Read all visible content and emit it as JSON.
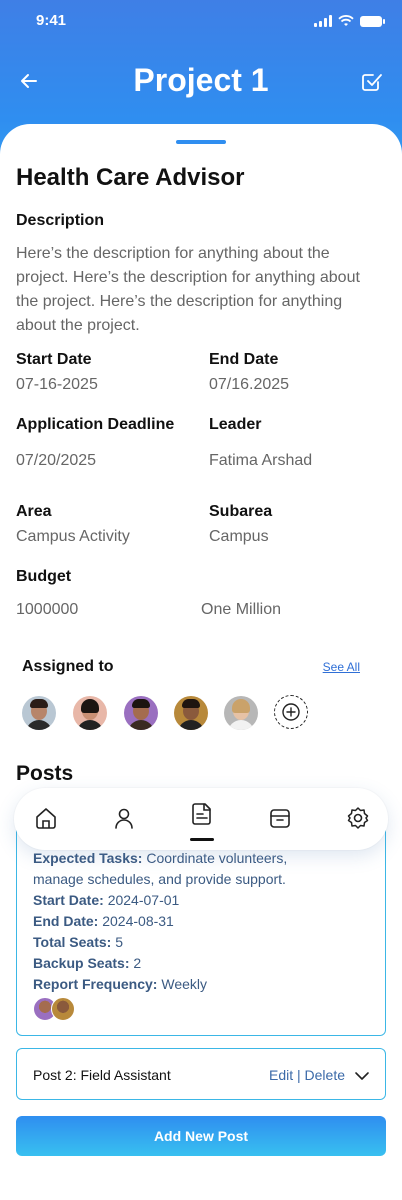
{
  "status_bar": {
    "time": "9:41"
  },
  "nav": {
    "title": "Project 1",
    "back_icon": "arrow-left-icon",
    "action_icon": "check-square-icon"
  },
  "project": {
    "name": "Health Care Advisor",
    "description_label": "Description",
    "description": "Here’s the description for anything about the project. Here’s the description for anything about the project. Here’s the description for anything about the project.",
    "start_date_label": "Start Date",
    "start_date": "07-16-2025",
    "end_date_label": "End Date",
    "end_date": "07/16.2025",
    "deadline_label": "Application Deadline",
    "deadline": "07/20/2025",
    "leader_label": "Leader",
    "leader": "Fatima Arshad",
    "area_label": "Area",
    "area": "Campus Activity",
    "subarea_label": "Subarea",
    "subarea": "Campus",
    "budget_label": "Budget",
    "budget": "1000000",
    "budget_words": "One Million"
  },
  "assigned": {
    "label": "Assigned to",
    "see_all": "See All",
    "avatars": 5
  },
  "posts": {
    "title": "Posts",
    "post1": {
      "tasks_label": "Expected Tasks:",
      "tasks_value": "Coordinate volunteers,",
      "tasks_value_2": "manage schedules, and provide support.",
      "start_label": "Start Date:",
      "start_value": "2024-07-01",
      "end_label": "End Date:",
      "end_value": "2024-08-31",
      "seats_label": "Total Seats:",
      "seats_value": "5",
      "backup_label": "Backup Seats:",
      "backup_value": "2",
      "report_label": "Report Frequency:",
      "report_value": "Weekly"
    },
    "post2": {
      "title": "Post 2: Field Assistant",
      "actions": "Edit | Delete"
    },
    "add_button": "Add New Post"
  },
  "tabbar": {
    "items": [
      "home-icon",
      "user-icon",
      "document-icon",
      "archive-icon",
      "settings-icon"
    ],
    "active": 2
  },
  "colors": {
    "accent": "#2f8ef0",
    "border": "#3bb7e6",
    "post_text": "#3b5a82"
  }
}
